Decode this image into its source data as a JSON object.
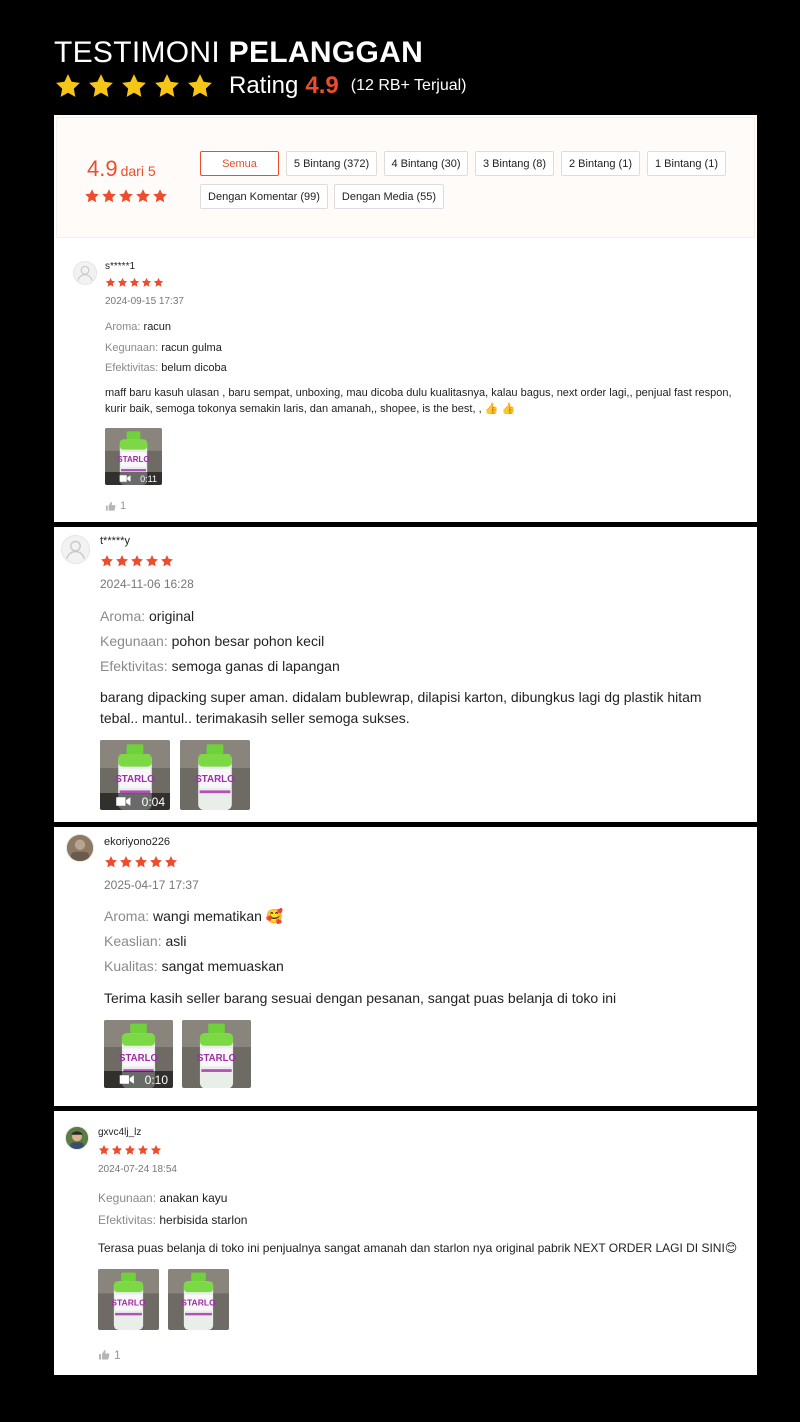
{
  "header": {
    "title_plain": "TESTIMONI",
    "title_bold": "PELANGGAN",
    "rating_word": "Rating",
    "rating_value": "4.9",
    "sold": "(12 RB+ Terjual)",
    "star_color": "#f5c518"
  },
  "summary": {
    "score": "4.9",
    "out_of": "dari 5",
    "filters": [
      "Semua",
      "5 Bintang (372)",
      "4 Bintang (30)",
      "3 Bintang (8)",
      "2 Bintang (1)",
      "1 Bintang (1)",
      "Dengan Komentar (99)",
      "Dengan Media (55)"
    ],
    "active_filter": "Semua"
  },
  "colors": {
    "accent": "#ee4d2d",
    "muted": "#8a8a8a"
  },
  "reviews": [
    {
      "username": "s*****1",
      "rating": 5,
      "date": "2024-09-15 17:37",
      "attributes": [
        {
          "key": "Aroma:",
          "value": "racun"
        },
        {
          "key": "Kegunaan:",
          "value": "racun gulma"
        },
        {
          "key": "Efektivitas:",
          "value": "belum dicoba"
        }
      ],
      "comment": "maff baru kasuh ulasan , baru sempat, unboxing, mau dicoba dulu kualitasnya, kalau bagus, next order lagi,, penjual fast respon, kurir baik, semoga tokonya semakin laris, dan amanah,, shopee, is the best, , 👍 👍",
      "media": [
        {
          "type": "video",
          "duration": "0:11"
        }
      ],
      "likes": "1"
    },
    {
      "username": "t*****y",
      "rating": 5,
      "date": "2024-11-06 16:28",
      "attributes": [
        {
          "key": "Aroma:",
          "value": "original"
        },
        {
          "key": "Kegunaan:",
          "value": "pohon besar pohon kecil"
        },
        {
          "key": "Efektivitas:",
          "value": "semoga ganas di lapangan"
        }
      ],
      "comment": "barang dipacking super aman. didalam bublewrap, dilapisi karton, dibungkus lagi dg plastik hitam tebal.. mantul..  terimakasih seller semoga sukses.",
      "media": [
        {
          "type": "video",
          "duration": "0:04"
        },
        {
          "type": "image"
        }
      ]
    },
    {
      "username": "ekoriyono226",
      "rating": 5,
      "date": "2025-04-17 17:37",
      "attributes": [
        {
          "key": "Aroma:",
          "value": "wangi mematikan 🥰"
        },
        {
          "key": "Keaslian:",
          "value": "asli"
        },
        {
          "key": "Kualitas:",
          "value": "sangat memuaskan"
        }
      ],
      "comment": "Terima kasih seller barang sesuai dengan pesanan, sangat puas belanja di toko ini",
      "media": [
        {
          "type": "video",
          "duration": "0:10"
        },
        {
          "type": "image"
        }
      ]
    },
    {
      "username": "gxvc4lj_lz",
      "rating": 5,
      "date": "2024-07-24 18:54",
      "attributes": [
        {
          "key": "Kegunaan:",
          "value": "anakan kayu"
        },
        {
          "key": "Efektivitas:",
          "value": "herbisida starlon"
        }
      ],
      "comment": "Terasa puas belanja di toko ini penjualnya sangat amanah dan starlon nya original pabrik NEXT ORDER LAGI DI SINI😊",
      "media": [
        {
          "type": "image"
        },
        {
          "type": "image"
        }
      ],
      "likes": "1"
    }
  ]
}
